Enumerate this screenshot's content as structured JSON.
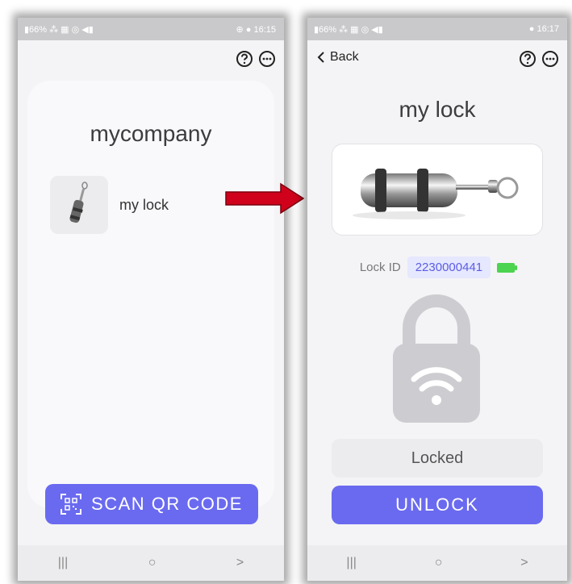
{
  "left_screen": {
    "status": {
      "left": "▮66% ⁂ ▦ ◎ ◀▮",
      "right": "⊕ ● 16:15"
    },
    "company": "mycompany",
    "items": [
      {
        "label": "my lock"
      }
    ],
    "scan_button": "SCAN QR CODE",
    "nav": [
      "|||",
      "○",
      ">"
    ]
  },
  "right_screen": {
    "status": {
      "left": "▮66% ⁂ ▦ ◎ ◀▮",
      "right": "● 16:17"
    },
    "back_label": "Back",
    "title": "my lock",
    "lock_id_label": "Lock ID",
    "lock_id": "2230000441",
    "status_text": "Locked",
    "unlock_button": "UNLOCK",
    "nav": [
      "|||",
      "○",
      ">"
    ]
  },
  "colors": {
    "accent": "#6a6af0",
    "arrow": "#d0021b",
    "battery": "#4cd34f"
  },
  "icons": {
    "help": "question-circle-icon",
    "more": "ellipsis-circle-icon",
    "qr": "qr-code-icon",
    "lock": "padlock-wifi-icon"
  }
}
